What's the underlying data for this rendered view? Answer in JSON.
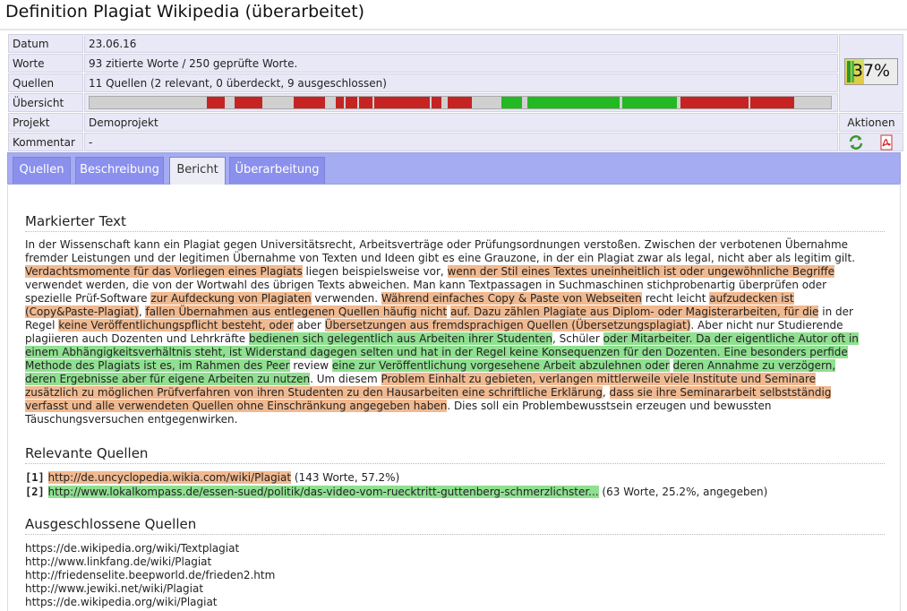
{
  "page": {
    "title": "Definition Plagiat Wikipedia (überarbeitet)"
  },
  "info": {
    "rows": [
      {
        "label": "Datum",
        "value": "23.06.16"
      },
      {
        "label": "Worte",
        "value": "93 zitierte Worte / 250 geprüfte Worte."
      },
      {
        "label": "Quellen",
        "value": "11 Quellen (2 relevant, 0 überdeckt, 9 ausgeschlossen)"
      },
      {
        "label": "Übersicht",
        "value": ""
      },
      {
        "label": "Projekt",
        "value": "Demoprojekt"
      },
      {
        "label": "Kommentar",
        "value": "-"
      }
    ],
    "percent": "37%",
    "percent_value": 0.37,
    "aktionen_label": "Aktionen",
    "actions": [
      {
        "name": "refresh-icon"
      },
      {
        "name": "pdf-icon"
      }
    ]
  },
  "colors": {
    "red": "#c62323",
    "green": "#22b922",
    "orange": "#f0b990",
    "lightgreen": "#8fe090",
    "tabs": "#8a90ec"
  },
  "overview_segments": [
    {
      "color": "red",
      "start": 0.158,
      "end": 0.182
    },
    {
      "color": "red",
      "start": 0.196,
      "end": 0.233
    },
    {
      "color": "red",
      "start": 0.275,
      "end": 0.318
    },
    {
      "color": "red",
      "start": 0.332,
      "end": 0.343
    },
    {
      "color": "red",
      "start": 0.345,
      "end": 0.361
    },
    {
      "color": "red",
      "start": 0.363,
      "end": 0.382
    },
    {
      "color": "red",
      "start": 0.384,
      "end": 0.459
    },
    {
      "color": "red",
      "start": 0.461,
      "end": 0.475
    },
    {
      "color": "red",
      "start": 0.483,
      "end": 0.516
    },
    {
      "color": "green",
      "start": 0.555,
      "end": 0.583
    },
    {
      "color": "green",
      "start": 0.59,
      "end": 0.715
    },
    {
      "color": "green",
      "start": 0.718,
      "end": 0.792
    },
    {
      "color": "red",
      "start": 0.797,
      "end": 0.889
    },
    {
      "color": "red",
      "start": 0.891,
      "end": 0.95
    }
  ],
  "tabs": [
    {
      "label": "Quellen",
      "active": false
    },
    {
      "label": "Beschreibung",
      "active": false
    },
    {
      "label": "Bericht",
      "active": true
    },
    {
      "label": "Überarbeitung",
      "active": false
    }
  ],
  "report": {
    "marked_heading": "Markierter Text",
    "segments": [
      {
        "t": "In der Wissenschaft kann ein Plagiat gegen Universitätsrecht, Arbeitsverträge oder Prüfungsordnungen verstoßen. Zwischen der verbotenen Übernahme fremder Leistungen und der legitimen Übernahme von Texten und Ideen gibt es eine Grauzone, in der ein Plagiat zwar als legal, nicht aber als legitim gilt. ",
        "c": ""
      },
      {
        "t": "Verdachtsmomente für das Vorliegen eines Plagiats",
        "c": "o"
      },
      {
        "t": " liegen beispielsweise vor, ",
        "c": ""
      },
      {
        "t": "wenn der Stil eines Textes uneinheitlich ist oder ungewöhnliche Begriffe",
        "c": "o"
      },
      {
        "t": " verwendet werden, die von der Wortwahl des übrigen Texts abweichen. Man kann Textpassagen in Suchmaschinen stichprobenartig überprüfen oder spezielle Prüf-Software ",
        "c": ""
      },
      {
        "t": "zur Aufdeckung von Plagiaten",
        "c": "o"
      },
      {
        "t": " verwenden. ",
        "c": ""
      },
      {
        "t": "Während einfaches Copy & Paste von Webseiten",
        "c": "o"
      },
      {
        "t": " recht leicht ",
        "c": ""
      },
      {
        "t": "aufzudecken ist (Copy&Paste-Plagiat)",
        "c": "o"
      },
      {
        "t": ", ",
        "c": ""
      },
      {
        "t": "fallen Übernahmen aus entlegenen Quellen häufig nicht",
        "c": "o"
      },
      {
        "t": " ",
        "c": ""
      },
      {
        "t": "auf. Dazu zählen Plagiate aus Diplom- oder Magisterarbeiten, für die",
        "c": "o"
      },
      {
        "t": " in der Regel ",
        "c": ""
      },
      {
        "t": "keine Veröffentlichungspflicht besteht, oder",
        "c": "o"
      },
      {
        "t": " aber ",
        "c": ""
      },
      {
        "t": "Übersetzungen aus fremdsprachigen Quellen (Übersetzungsplagiat)",
        "c": "o"
      },
      {
        "t": ". Aber nicht nur Studierende plagiieren auch Dozenten und Lehrkräfte ",
        "c": ""
      },
      {
        "t": "bedienen sich gelegentlich aus Arbeiten ihrer Studenten",
        "c": "g"
      },
      {
        "t": ", Schüler ",
        "c": ""
      },
      {
        "t": "oder Mitarbeiter. Da der eigentliche Autor oft in einem Abhängigkeitsverhältnis steht, ist Widerstand dagegen selten und hat in der Regel keine Konsequenzen für den Dozenten. Eine besonders perfide Methode des Plagiats ist es, im Rahmen des Peer",
        "c": "g"
      },
      {
        "t": " review ",
        "c": ""
      },
      {
        "t": "eine zur Veröffentlichung vorgesehene Arbeit abzulehnen oder",
        "c": "g"
      },
      {
        "t": " ",
        "c": ""
      },
      {
        "t": "deren Annahme zu verzögern, deren Ergebnisse aber für eigene Arbeiten zu nutzen",
        "c": "g"
      },
      {
        "t": ". Um diesem ",
        "c": ""
      },
      {
        "t": "Problem Einhalt zu gebieten, verlangen mittlerweile viele Institute und Seminare zusätzlich zu möglichen Prüfverfahren von ihren Studenten zu den Hausarbeiten eine schriftliche Erklärung",
        "c": "o"
      },
      {
        "t": ", ",
        "c": ""
      },
      {
        "t": "dass sie ihre Seminararbeit selbstständig verfasst und alle verwendeten Quellen ohne Einschränkung angegeben haben",
        "c": "o"
      },
      {
        "t": ". Dies soll ein Problembewusstsein erzeugen und bewussten Täuschungsversuchen entgegenwirken.",
        "c": ""
      }
    ],
    "relevant_heading": "Relevante Quellen",
    "relevant": [
      {
        "num": "[1]",
        "url": "http://de.uncyclopedia.wikia.com/wiki/Plagiat",
        "info": " (143 Worte, 57.2%)",
        "c": "o"
      },
      {
        "num": "[2]",
        "url": "http://www.lokalkompass.de/essen-sued/politik/das-video-vom-ruecktritt-guttenberg-schmerzlichster...",
        "info": " (63 Worte, 25.2%, angegeben)",
        "c": "g"
      }
    ],
    "excluded_heading": "Ausgeschlossene Quellen",
    "excluded": [
      "https://de.wikipedia.org/wiki/Textplagiat",
      "http://www.linkfang.de/wiki/Plagiat",
      "http://friedenselite.beepworld.de/frieden2.htm",
      "http://www.jewiki.net/wiki/Plagiat",
      "https://de.wikipedia.org/wiki/Plagiat"
    ]
  }
}
